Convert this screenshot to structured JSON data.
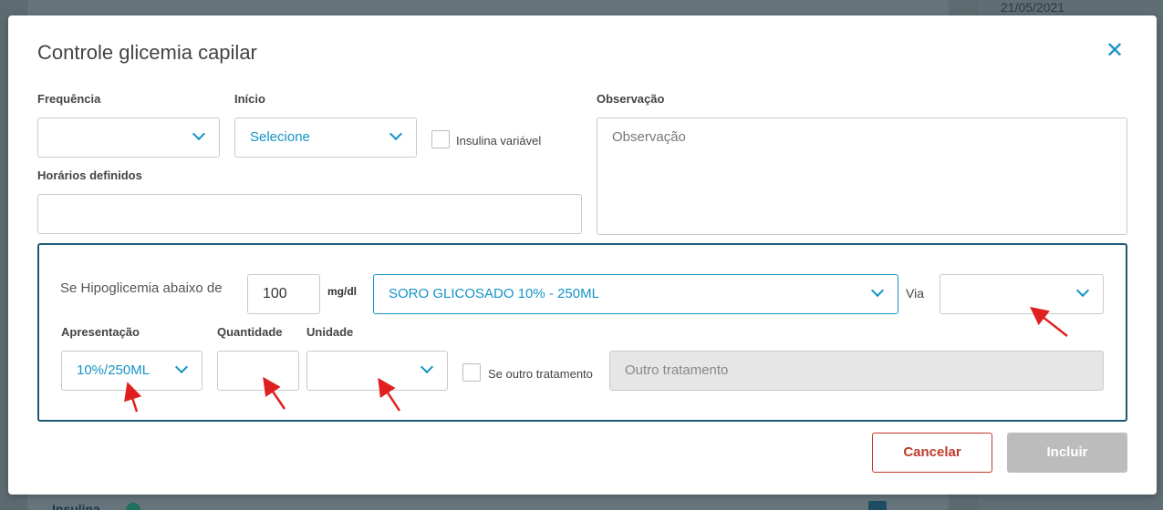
{
  "background": {
    "date": "21/05/2021",
    "section_label": "Insulina"
  },
  "modal": {
    "title": "Controle glicemia capilar",
    "close_icon": "close-icon"
  },
  "form": {
    "frequencia_label": "Frequência",
    "frequencia_value": "",
    "inicio_label": "Início",
    "inicio_value": "Selecione",
    "insulina_variavel_label": "Insulina variável",
    "horarios_label": "Horários definidos",
    "horarios_value": "",
    "observacao_label": "Observação",
    "observacao_placeholder": "Observação"
  },
  "hypoglycemia": {
    "label": "Se Hipoglicemia abaixo de",
    "threshold_value": "100",
    "unit": "mg/dl",
    "medication_value": "SORO GLICOSADO 10% - 250ML",
    "via_label": "Via",
    "via_value": "",
    "apresentacao_label": "Apresentação",
    "apresentacao_value": "10%/250ML",
    "quantidade_label": "Quantidade",
    "quantidade_value": "",
    "unidade_label": "Unidade",
    "unidade_value": "",
    "outro_tratamento_checkbox_label": "Se outro tratamento",
    "outro_tratamento_placeholder": "Outro tratamento"
  },
  "actions": {
    "cancel_label": "Cancelar",
    "submit_label": "Incluir"
  },
  "colors": {
    "accent": "#1494c8",
    "border_highlight": "#1e5a76",
    "cancel": "#c0392b",
    "disabled": "#bcbcbc",
    "arrow": "#e02020"
  }
}
